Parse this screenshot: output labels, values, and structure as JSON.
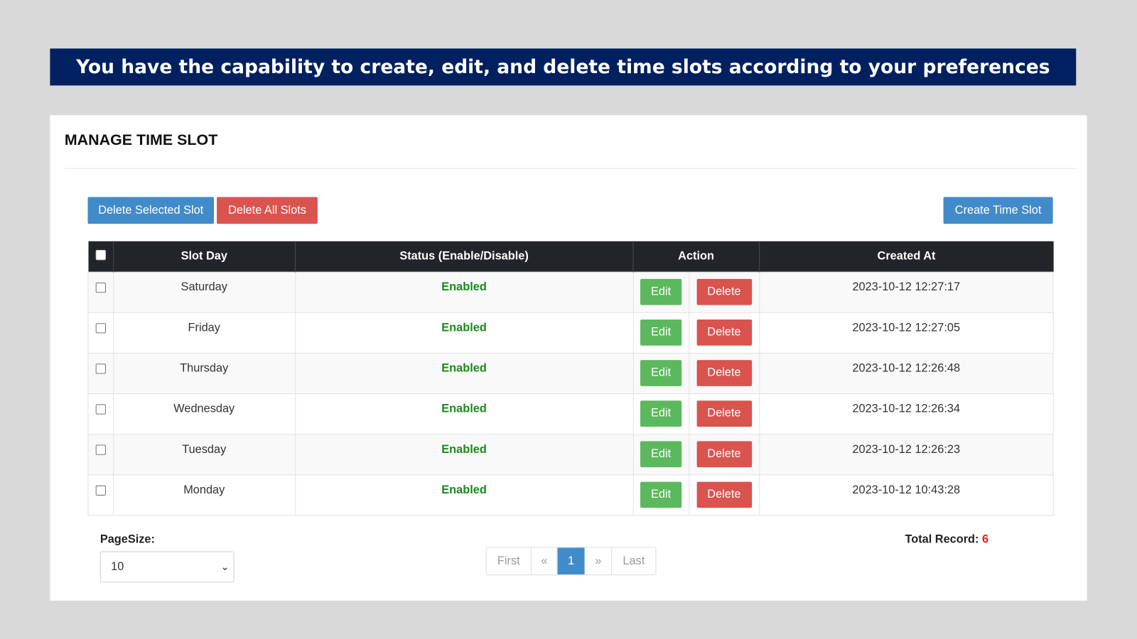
{
  "banner": "You have the capability to create, edit, and delete time slots according to your preferences",
  "title": "MANAGE TIME SLOT",
  "toolbar": {
    "delete_selected": "Delete Selected Slot",
    "delete_all": "Delete All Slots",
    "create": "Create Time Slot"
  },
  "table": {
    "headers": [
      "Slot Day",
      "Status (Enable/Disable)",
      "Action",
      "Created At"
    ],
    "edit_label": "Edit",
    "delete_label": "Delete",
    "rows": [
      {
        "day": "Saturday",
        "status": "Enabled",
        "created": "2023-10-12 12:27:17"
      },
      {
        "day": "Friday",
        "status": "Enabled",
        "created": "2023-10-12 12:27:05"
      },
      {
        "day": "Thursday",
        "status": "Enabled",
        "created": "2023-10-12 12:26:48"
      },
      {
        "day": "Wednesday",
        "status": "Enabled",
        "created": "2023-10-12 12:26:34"
      },
      {
        "day": "Tuesday",
        "status": "Enabled",
        "created": "2023-10-12 12:26:23"
      },
      {
        "day": "Monday",
        "status": "Enabled",
        "created": "2023-10-12 10:43:28"
      }
    ]
  },
  "footer": {
    "page_size_label": "PageSize:",
    "page_size": "10",
    "pagination": [
      "First",
      "«",
      "1",
      "»",
      "Last"
    ],
    "current_page": "1",
    "total_label": "Total Record:",
    "total": "6"
  },
  "colors": {
    "banner": "#002060",
    "primary": "#428bca",
    "danger": "#d9534f",
    "success": "#5cb85c",
    "enabled": "#1a8a1a"
  }
}
